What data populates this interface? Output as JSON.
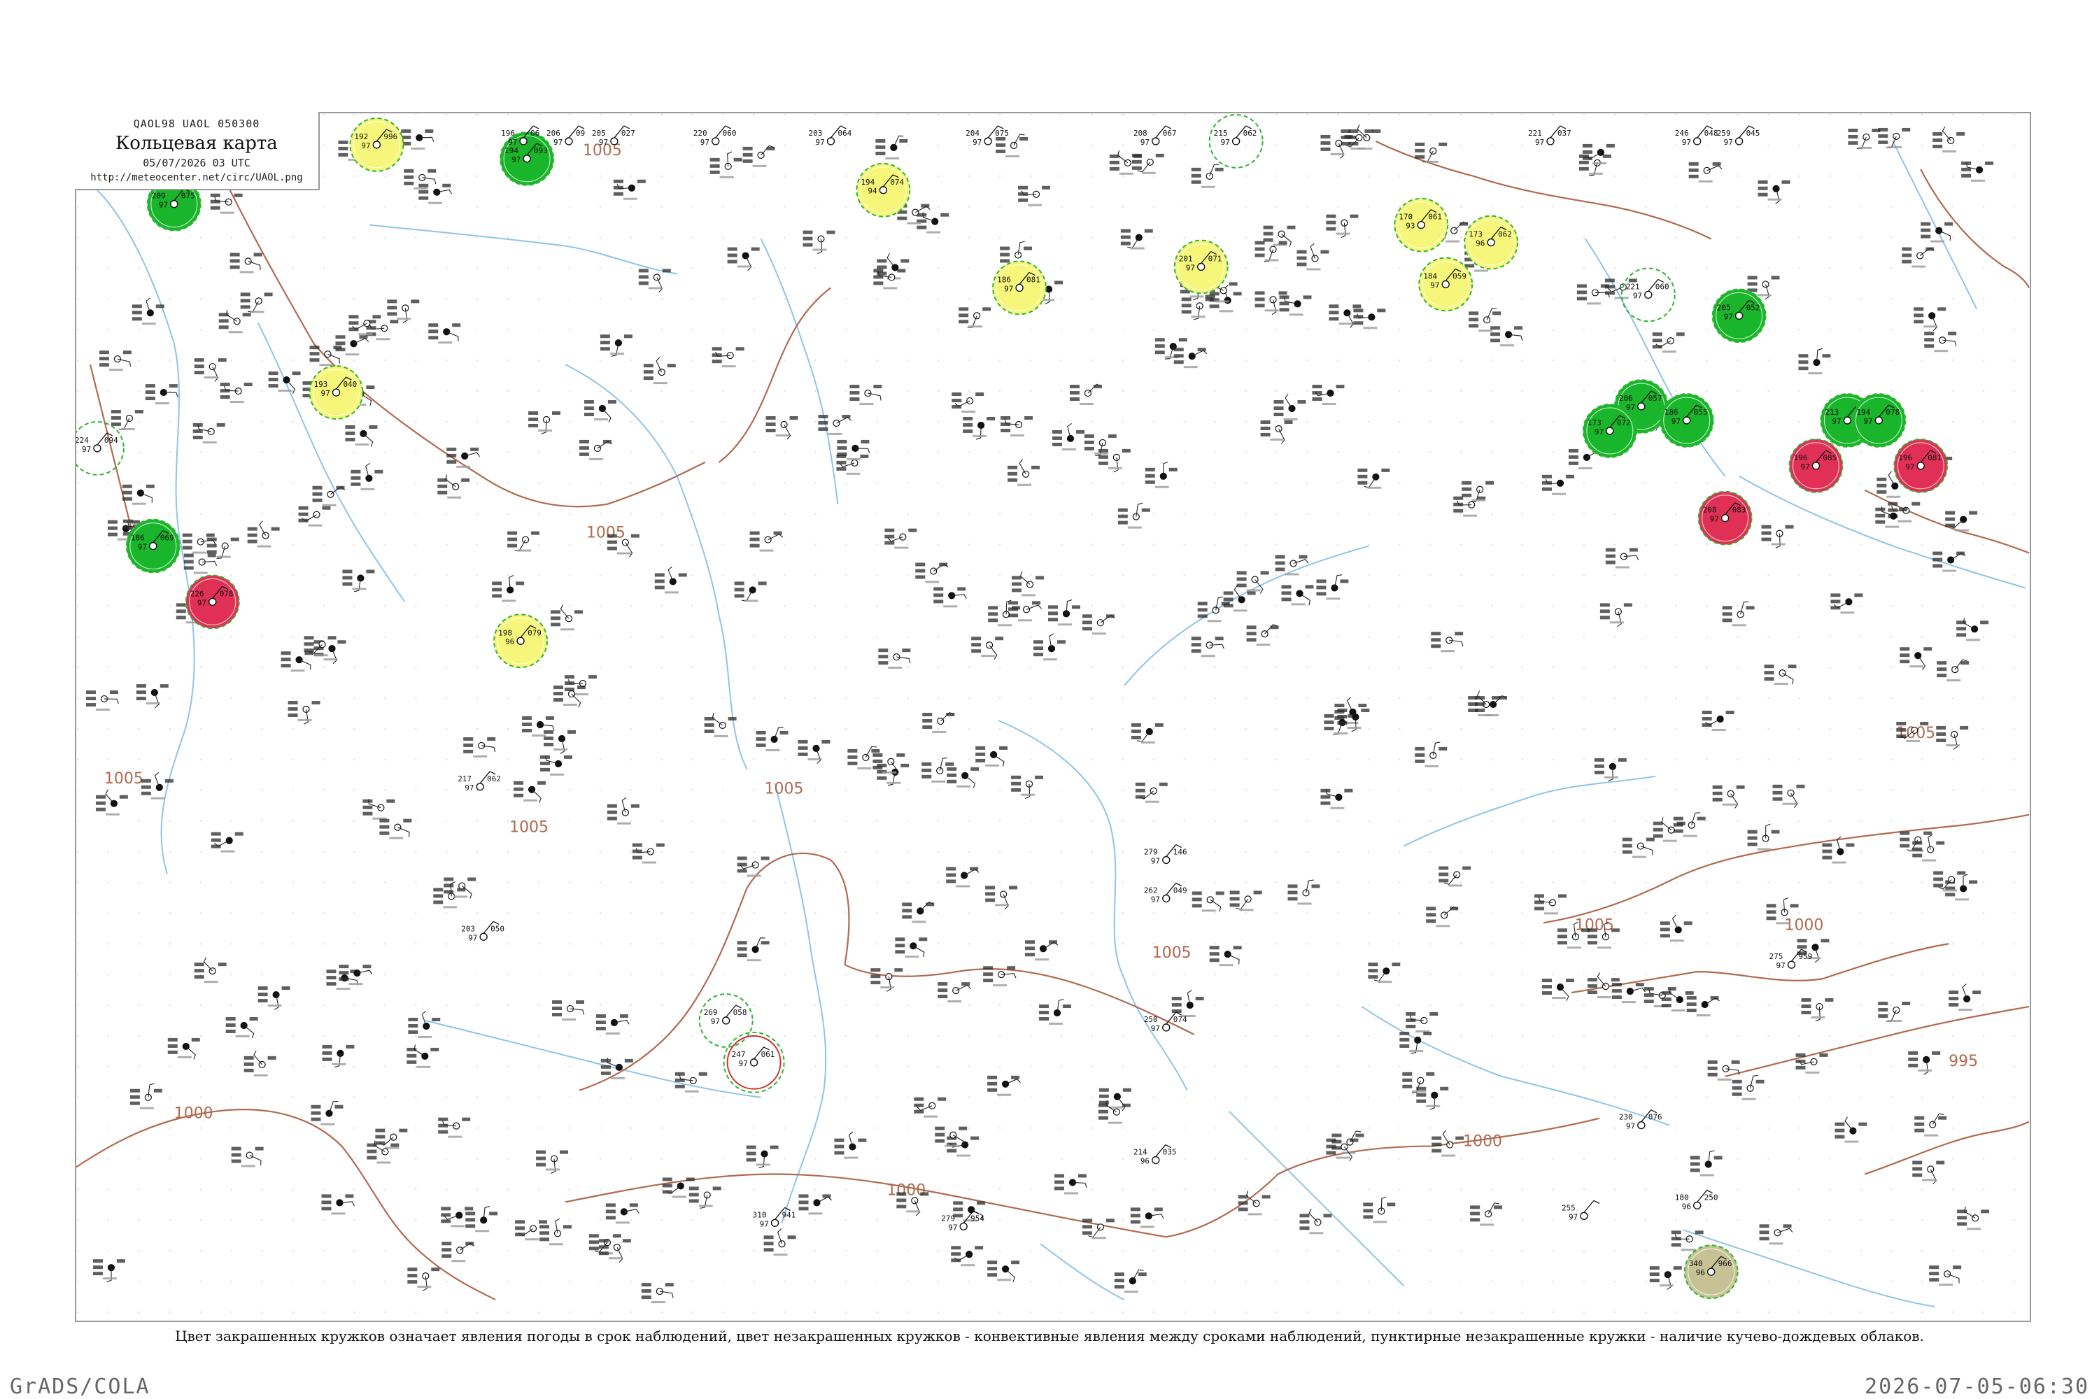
{
  "header": {
    "code_line": "QAOL98  UAOL  050300",
    "title": "Кольцевая карта",
    "datetime": "05/07/2026 03 UTC",
    "url": "http://meteocenter.net/circ/UAOL.png"
  },
  "legend_note": "Цвет закрашенных кружков означает явления погоды в срок наблюдений, цвет незакрашенных кружков - конвективные явления между сроками наблюдений, пунктирные незакрашенные кружки - наличие кучево-дождевых облаков.",
  "footer": {
    "left": "GrADS/COLA",
    "right": "2026-07-05-06:30"
  },
  "colors": {
    "isobar": "#b06a4f",
    "water": "#8fc4ea",
    "phenomena_green": "#19b52b",
    "phenomena_yellow": "#f6f77a",
    "phenomena_red": "#e03055",
    "phenomena_olive": "#c6c296",
    "convective_ring": "#2fb52f",
    "storm_ring": "#d03030"
  },
  "isobar_labels": [
    "1005",
    "1005",
    "1005",
    "1005",
    "1005",
    "1005",
    "1005",
    "1005",
    "1000",
    "1000",
    "1000",
    "1000",
    "995"
  ],
  "stations": [
    {
      "id": "s1",
      "p": "192",
      "t": "97",
      "d": "996",
      "n": "",
      "fill": "yellow"
    },
    {
      "id": "s2",
      "p": "194",
      "t": "97",
      "d": "093",
      "n": "",
      "fill": "green"
    },
    {
      "id": "s3",
      "p": "196",
      "t": "97",
      "d": "06",
      "n": "",
      "fill": "none"
    },
    {
      "id": "s4",
      "p": "206",
      "t": "97",
      "d": "09",
      "n": "",
      "fill": "none"
    },
    {
      "id": "s5",
      "p": "205",
      "t": "97",
      "d": "027",
      "n": "",
      "fill": "none"
    },
    {
      "id": "s6",
      "p": "220",
      "t": "97",
      "d": "060",
      "n": "",
      "fill": "none"
    },
    {
      "id": "s7",
      "p": "203",
      "t": "97",
      "d": "064",
      "n": "",
      "fill": "none"
    },
    {
      "id": "s8",
      "p": "194",
      "t": "94",
      "d": "074",
      "n": "",
      "fill": "yellow"
    },
    {
      "id": "s9",
      "p": "204",
      "t": "97",
      "d": "075",
      "n": "",
      "fill": "none"
    },
    {
      "id": "s10",
      "p": "208",
      "t": "97",
      "d": "067",
      "n": "",
      "fill": "none"
    },
    {
      "id": "s11",
      "p": "215",
      "t": "97",
      "d": "062",
      "n": "",
      "fill": "none"
    },
    {
      "id": "s12",
      "p": "221",
      "t": "97",
      "d": "037",
      "n": "",
      "fill": "none"
    },
    {
      "id": "s13",
      "p": "259",
      "t": "97",
      "d": "045",
      "n": "",
      "fill": "none"
    },
    {
      "id": "s14",
      "p": "246",
      "t": "97",
      "d": "048",
      "n": "",
      "fill": "none"
    },
    {
      "id": "s15",
      "p": "186",
      "t": "97",
      "d": "081",
      "n": "",
      "fill": "yellow"
    },
    {
      "id": "s16",
      "p": "201",
      "t": "97",
      "d": "071",
      "n": "",
      "fill": "yellow"
    },
    {
      "id": "s17",
      "p": "170",
      "t": "93",
      "d": "061",
      "n": "",
      "fill": "yellow"
    },
    {
      "id": "s18",
      "p": "173",
      "t": "96",
      "d": "062",
      "n": "",
      "fill": "yellow"
    },
    {
      "id": "s19",
      "p": "184",
      "t": "97",
      "d": "059",
      "n": "",
      "fill": "yellow"
    },
    {
      "id": "s20",
      "p": "193",
      "t": "97",
      "d": "040",
      "n": "",
      "fill": "yellow"
    },
    {
      "id": "s21",
      "p": "198",
      "t": "96",
      "d": "079",
      "n": "",
      "fill": "yellow"
    },
    {
      "id": "s22",
      "p": "209",
      "t": "97",
      "d": "075",
      "n": "",
      "fill": "green"
    },
    {
      "id": "s23",
      "p": "224",
      "t": "97",
      "d": "094",
      "n": "",
      "fill": "none"
    },
    {
      "id": "s24",
      "p": "226",
      "t": "97",
      "d": "078",
      "n": "",
      "fill": "red"
    },
    {
      "id": "s25",
      "p": "186",
      "t": "97",
      "d": "069",
      "n": "",
      "fill": "green"
    },
    {
      "id": "s26",
      "p": "221",
      "t": "97",
      "d": "060",
      "n": "",
      "fill": "none"
    },
    {
      "id": "s27",
      "p": "205",
      "t": "97",
      "d": "052",
      "n": "",
      "fill": "green"
    },
    {
      "id": "s28",
      "p": "213",
      "t": "97",
      "d": "071",
      "n": "",
      "fill": "green"
    },
    {
      "id": "s29",
      "p": "206",
      "t": "97",
      "d": "057",
      "n": "",
      "fill": "green"
    },
    {
      "id": "s30",
      "p": "186",
      "t": "97",
      "d": "055",
      "n": "",
      "fill": "green"
    },
    {
      "id": "s31",
      "p": "173",
      "t": "97",
      "d": "072",
      "n": "",
      "fill": "green"
    },
    {
      "id": "s32",
      "p": "194",
      "t": "97",
      "d": "078",
      "n": "",
      "fill": "green"
    },
    {
      "id": "s33",
      "p": "196",
      "t": "97",
      "d": "085",
      "n": "",
      "fill": "red"
    },
    {
      "id": "s34",
      "p": "196",
      "t": "97",
      "d": "081",
      "n": "",
      "fill": "red"
    },
    {
      "id": "s35",
      "p": "208",
      "t": "97",
      "d": "083",
      "n": "",
      "fill": "red"
    },
    {
      "id": "s36",
      "p": "340",
      "t": "96",
      "d": "966",
      "n": "",
      "fill": "olive"
    },
    {
      "id": "s37",
      "p": "269",
      "t": "97",
      "d": "058",
      "n": "",
      "fill": "none"
    },
    {
      "id": "s38",
      "p": "247",
      "t": "97",
      "d": "061",
      "n": "",
      "fill": "none"
    },
    {
      "id": "s39",
      "p": "217",
      "t": "97",
      "d": "062",
      "n": "",
      "fill": "none"
    },
    {
      "id": "s40",
      "p": "203",
      "t": "97",
      "d": "050",
      "n": "",
      "fill": "none"
    },
    {
      "id": "s41",
      "p": "250",
      "t": "97",
      "d": "074",
      "n": "",
      "fill": "none"
    },
    {
      "id": "s42",
      "p": "230",
      "t": "97",
      "d": "076",
      "n": "",
      "fill": "none"
    },
    {
      "id": "s43",
      "p": "275",
      "t": "97",
      "d": "959",
      "n": "",
      "fill": "none"
    },
    {
      "id": "s44",
      "p": "310",
      "t": "97",
      "d": "941",
      "n": "",
      "fill": "none"
    },
    {
      "id": "s45",
      "p": "279",
      "t": "97",
      "d": "954",
      "n": "",
      "fill": "none"
    },
    {
      "id": "s46",
      "p": "214",
      "t": "96",
      "d": "035",
      "n": "",
      "fill": "none"
    },
    {
      "id": "s47",
      "p": "279",
      "t": "97",
      "d": "146",
      "n": "",
      "fill": "none"
    },
    {
      "id": "s48",
      "p": "262",
      "t": "97",
      "d": "049",
      "n": "",
      "fill": "none"
    },
    {
      "id": "s49",
      "p": "255",
      "t": "97",
      "d": "",
      "n": "",
      "fill": "none"
    },
    {
      "id": "s50",
      "p": "180",
      "t": "96",
      "d": "250",
      "n": "",
      "fill": "none"
    }
  ]
}
